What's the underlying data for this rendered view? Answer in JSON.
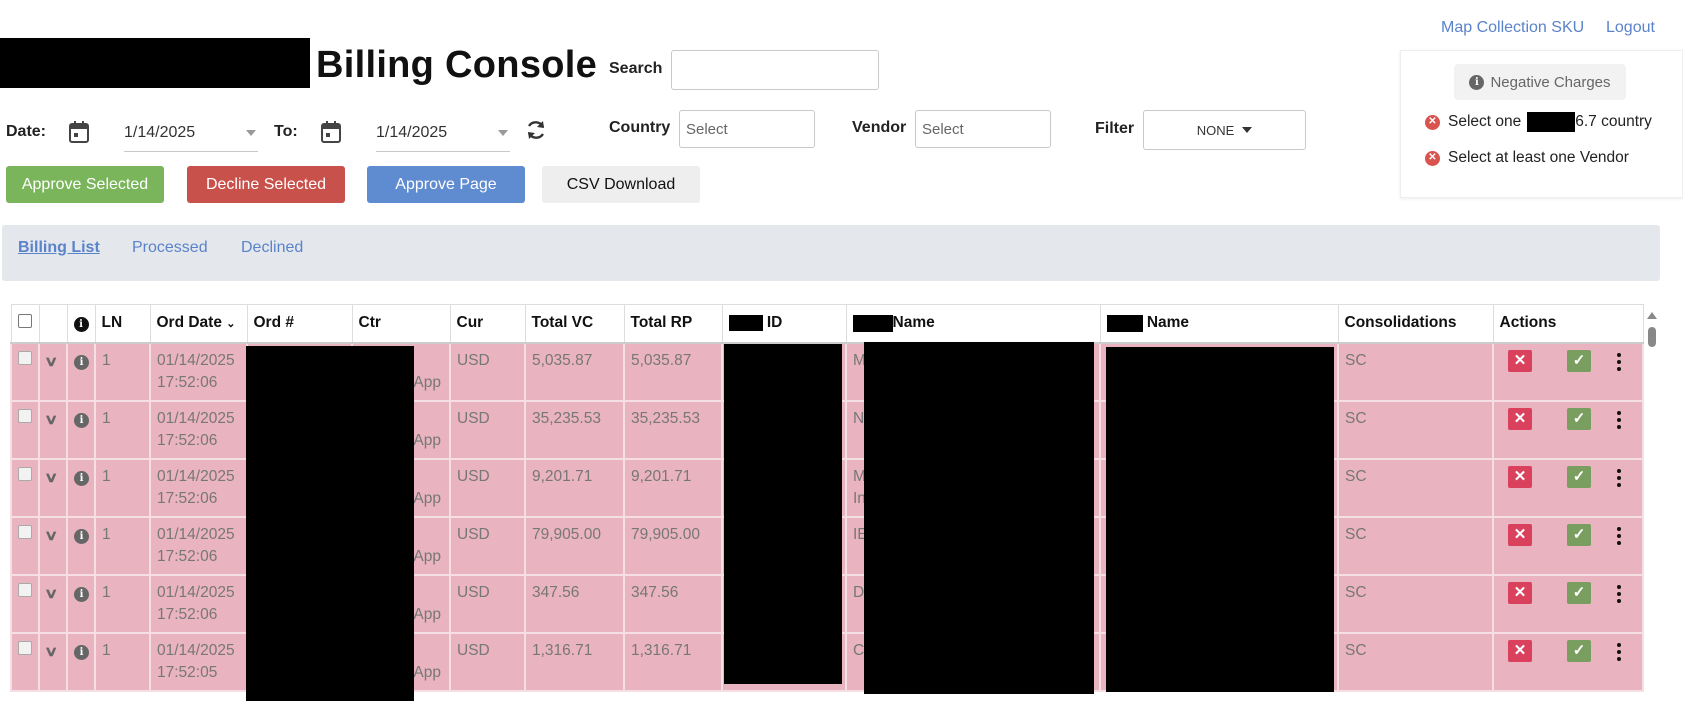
{
  "header": {
    "title": "Billing Console",
    "links": {
      "map_sku": "Map Collection SKU",
      "logout": "Logout"
    },
    "search_label": "Search",
    "search_value": ""
  },
  "filters": {
    "date_label": "Date:",
    "date_from": "1/14/2025",
    "to_label": "To:",
    "date_to": "1/14/2025",
    "country_label": "Country",
    "country_placeholder": "Select",
    "vendor_label": "Vendor",
    "vendor_placeholder": "Select",
    "filter_label": "Filter",
    "filter_value": "NONE"
  },
  "buttons": {
    "approve_selected": "Approve Selected",
    "decline_selected": "Decline Selected",
    "approve_page": "Approve Page",
    "csv_download": "CSV Download"
  },
  "colors": {
    "approve": "#7ab55c",
    "decline": "#c9514c",
    "approve_page": "#5f8bd0",
    "csv": "#eeeeee",
    "row_bg": "#e9b3bf",
    "decline_icon": "#d9415d",
    "approve_icon": "#7a9e5f"
  },
  "negative_panel": {
    "button": "Negative Charges",
    "err_country_prefix": "Select one",
    "err_country_suffix": "6.7 country",
    "err_vendor": "Select at least one Vendor"
  },
  "tabs": [
    "Billing List",
    "Processed",
    "Declined"
  ],
  "table": {
    "headers": {
      "ln": "LN",
      "ord_date": "Ord Date",
      "ord_num": "Ord #",
      "ctr": "Ctr",
      "cur": "Cur",
      "total_vc": "Total VC",
      "total_rp": "Total RP",
      "id": "ID",
      "name1": "Name",
      "name2": "Name",
      "consolidations": "Consolidations",
      "actions": "Actions"
    },
    "rows": [
      {
        "ln": "1",
        "date": "01/14/2025",
        "time": "17:52:06",
        "ctr_tail": "App",
        "cur": "USD",
        "vc": "5,035.87",
        "rp": "5,035.87",
        "name_a": "M",
        "name_b": "",
        "cons": "SC"
      },
      {
        "ln": "1",
        "date": "01/14/2025",
        "time": "17:52:06",
        "ctr_tail": "App",
        "cur": "USD",
        "vc": "35,235.53",
        "rp": "35,235.53",
        "name_a": "N",
        "name_b": "",
        "cons": "SC"
      },
      {
        "ln": "1",
        "date": "01/14/2025",
        "time": "17:52:06",
        "ctr_tail": "App",
        "cur": "USD",
        "vc": "9,201.71",
        "rp": "9,201.71",
        "name_a": "M",
        "name_b": "In",
        "cons": "SC"
      },
      {
        "ln": "1",
        "date": "01/14/2025",
        "time": "17:52:06",
        "ctr_tail": "App",
        "cur": "USD",
        "vc": "79,905.00",
        "rp": "79,905.00",
        "name_a": "IE",
        "name_b": "",
        "cons": "SC"
      },
      {
        "ln": "1",
        "date": "01/14/2025",
        "time": "17:52:06",
        "ctr_tail": "App",
        "cur": "USD",
        "vc": "347.56",
        "rp": "347.56",
        "name_a": "D",
        "name_b": "",
        "cons": "SC"
      },
      {
        "ln": "1",
        "date": "01/14/2025",
        "time": "17:52:05",
        "ctr_tail": "App",
        "cur": "USD",
        "vc": "1,316.71",
        "rp": "1,316.71",
        "name_a": "C",
        "name_b": "",
        "cons": "SC"
      }
    ]
  },
  "icons": {
    "calendar": "calendar-icon",
    "refresh": "refresh-icon",
    "info": "info-icon",
    "chevron": "chevron-down-icon",
    "decline": "close-icon",
    "approve": "check-icon",
    "more": "kebab-menu-icon"
  }
}
